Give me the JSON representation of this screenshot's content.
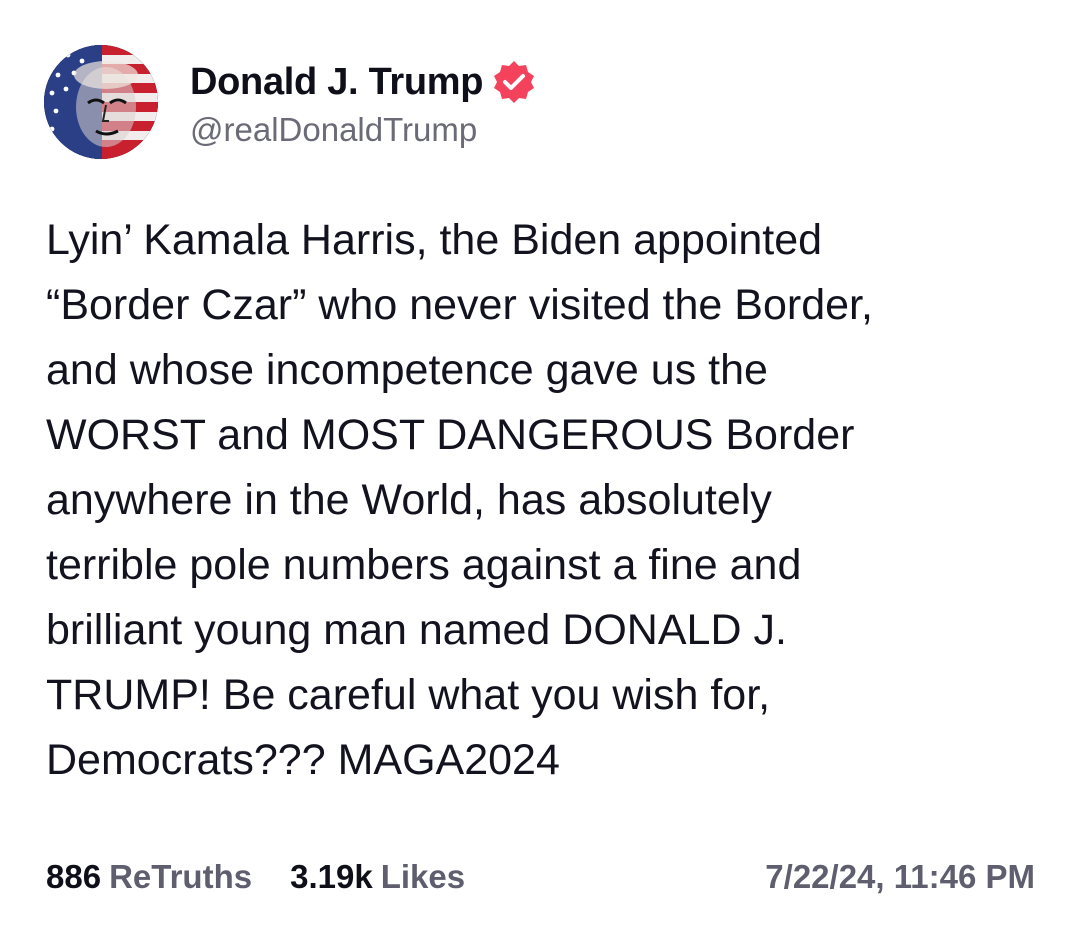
{
  "author": {
    "display_name": "Donald J. Trump",
    "handle": "@realDonaldTrump",
    "avatar_icon": "flag-portrait-avatar",
    "verified_icon": "verified-badge-icon",
    "verified_color": "#f5425c"
  },
  "post": {
    "text": "Lyin’ Kamala Harris, the Biden appointed\n“Border Czar” who never visited the Border,\nand whose incompetence gave us the\nWORST and MOST DANGEROUS Border\nanywhere in the World, has absolutely\nterrible pole numbers against a fine and\nbrilliant young man named DONALD J.\nTRUMP! Be careful what you wish for,\nDemocrats??? MAGA2024"
  },
  "stats": {
    "retruths_count": "886",
    "retruths_label": "ReTruths",
    "likes_count": "3.19k",
    "likes_label": "Likes",
    "timestamp": "7/22/24, 11:46 PM"
  }
}
